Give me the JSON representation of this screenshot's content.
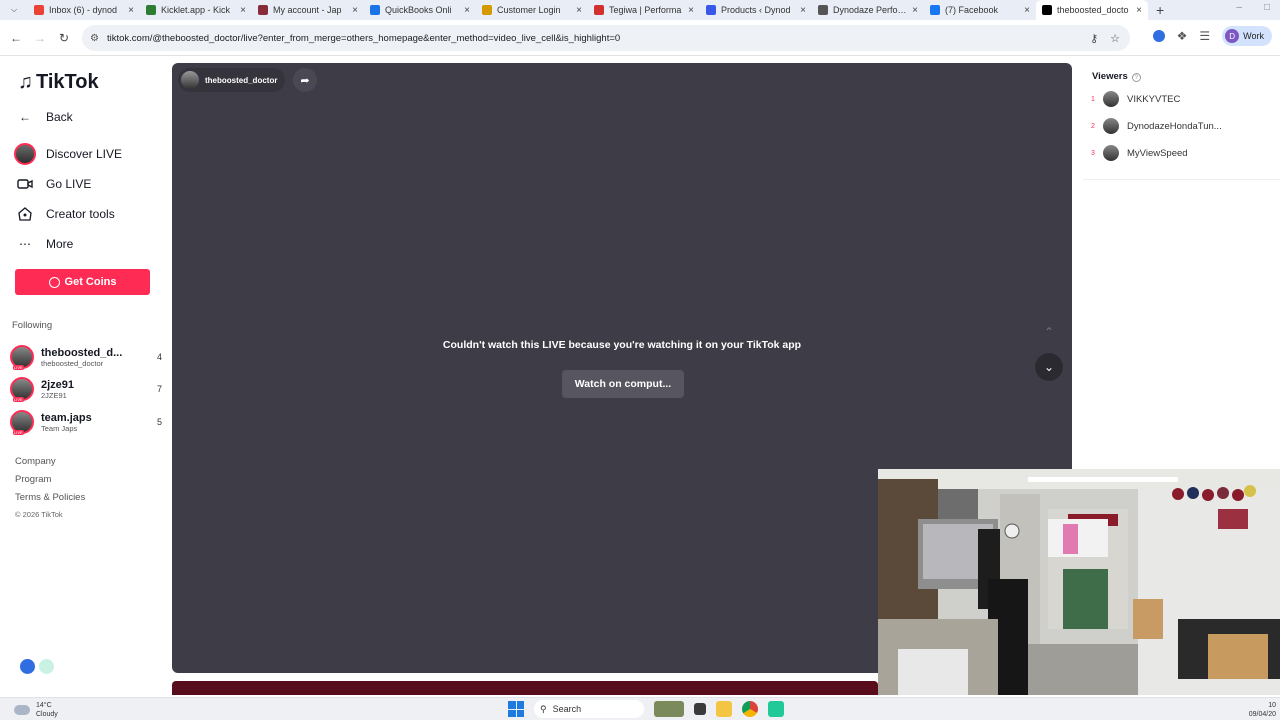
{
  "browser": {
    "tabs": [
      {
        "title": "Inbox (6) - dynod",
        "icon": "gmail-icon",
        "color": "#ea4335"
      },
      {
        "title": "Kicklet.app - Kick",
        "icon": "kicklet-icon",
        "color": "#2e7d32"
      },
      {
        "title": "My account - Jap",
        "icon": "japs-icon",
        "color": "#8a2b3a"
      },
      {
        "title": "QuickBooks Onli",
        "icon": "quickbooks-icon",
        "color": "#1a73e8"
      },
      {
        "title": "Customer Login",
        "icon": "bc-icon",
        "color": "#d49a00"
      },
      {
        "title": "Tegiwa | Performa",
        "icon": "tegiwa-icon",
        "color": "#d32f2f"
      },
      {
        "title": "Products ‹ Dynod",
        "icon": "wordpress-icon",
        "color": "#3858e9"
      },
      {
        "title": "Dynodaze Perform",
        "icon": "globe-icon",
        "color": "#555555"
      },
      {
        "title": "(7) Facebook",
        "icon": "facebook-icon",
        "color": "#1877f2"
      },
      {
        "title": "theboosted_docto",
        "icon": "tiktok-icon",
        "color": "#000000",
        "active": true
      }
    ],
    "url": "tiktok.com/@theboosted_doctor/live?enter_from_merge=others_homepage&enter_method=video_live_cell&is_highlight=0",
    "profile_label": "Work",
    "profile_initial": "D"
  },
  "sidebar": {
    "logo": "TikTok",
    "nav": [
      {
        "label": "Back",
        "icon": "back-arrow-icon"
      },
      {
        "label": "Discover LIVE",
        "icon": "live-avatar-icon"
      },
      {
        "label": "Go LIVE",
        "icon": "video-camera-icon"
      },
      {
        "label": "Creator tools",
        "icon": "lightbulb-icon"
      },
      {
        "label": "More",
        "icon": "ellipsis-icon"
      }
    ],
    "coins_label": "Get Coins",
    "following_header": "Following",
    "following": [
      {
        "name": "theboosted_d...",
        "sub": "theboosted_doctor",
        "count": "4"
      },
      {
        "name": "2jze91",
        "sub": "2JZE91",
        "count": "7"
      },
      {
        "name": "team.japs",
        "sub": "Team Japs",
        "count": "5"
      }
    ],
    "footer_links": [
      "Company",
      "Program",
      "Terms & Policies"
    ],
    "copyright": "© 2026 TikTok"
  },
  "player": {
    "host_name": "theboosted_doctor",
    "message": "Couldn't watch this LIVE because you're watching it on your TikTok app",
    "watch_button": "Watch on comput..."
  },
  "viewers": {
    "header": "Viewers",
    "list": [
      {
        "rank": "1",
        "name": "VIKKYVTEC"
      },
      {
        "rank": "2",
        "name": "DynodazeHondaTun..."
      },
      {
        "rank": "3",
        "name": "MyViewSpeed"
      }
    ]
  },
  "taskbar": {
    "temperature": "14°C",
    "condition": "Cloudy",
    "search_label": "Search",
    "time": "10",
    "date": "09/04/20"
  }
}
